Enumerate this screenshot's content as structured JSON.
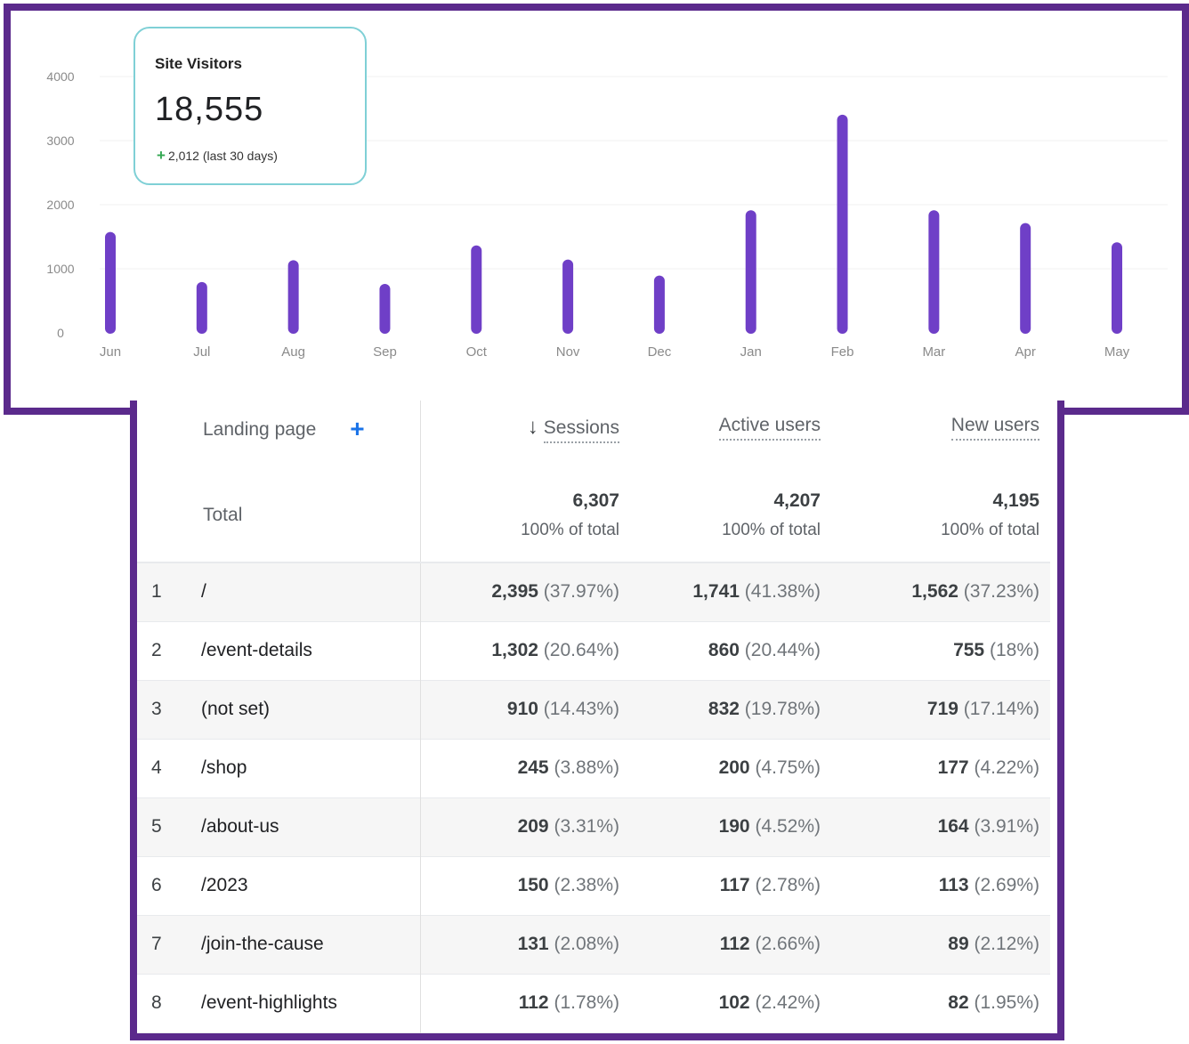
{
  "chart_data": {
    "type": "bar",
    "categories": [
      "Jun",
      "Jul",
      "Aug",
      "Sep",
      "Oct",
      "Nov",
      "Dec",
      "Jan",
      "Feb",
      "Mar",
      "Apr",
      "May"
    ],
    "values": [
      1560,
      780,
      1120,
      750,
      1350,
      1130,
      880,
      1900,
      3390,
      1900,
      1700,
      1400
    ],
    "title": "",
    "xlabel": "",
    "ylabel": "",
    "ylim": [
      0,
      4000
    ],
    "yticks": [
      0,
      1000,
      2000,
      3000,
      4000
    ],
    "grid": true,
    "bar_color": "#6f3fc7"
  },
  "kpi": {
    "title": "Site Visitors",
    "value": "18,555",
    "delta_symbol": "+",
    "delta_text": "2,012 (last 30 days)"
  },
  "table": {
    "headers": {
      "landing_page": "Landing page",
      "add_symbol": "+",
      "sort_symbol": "↓",
      "sessions": "Sessions",
      "active_users": "Active users",
      "new_users": "New users"
    },
    "total": {
      "label": "Total",
      "sessions": "6,307",
      "active_users": "4,207",
      "new_users": "4,195",
      "pct_label": "100% of total"
    },
    "rows": [
      {
        "idx": "1",
        "page": "/",
        "sessions": "2,395",
        "sessions_pct": "(37.97%)",
        "active": "1,741",
        "active_pct": "(41.38%)",
        "new": "1,562",
        "new_pct": "(37.23%)"
      },
      {
        "idx": "2",
        "page": "/event-details",
        "sessions": "1,302",
        "sessions_pct": "(20.64%)",
        "active": "860",
        "active_pct": "(20.44%)",
        "new": "755",
        "new_pct": "(18%)"
      },
      {
        "idx": "3",
        "page": "(not set)",
        "sessions": "910",
        "sessions_pct": "(14.43%)",
        "active": "832",
        "active_pct": "(19.78%)",
        "new": "719",
        "new_pct": "(17.14%)"
      },
      {
        "idx": "4",
        "page": "/shop",
        "sessions": "245",
        "sessions_pct": "(3.88%)",
        "active": "200",
        "active_pct": "(4.75%)",
        "new": "177",
        "new_pct": "(4.22%)"
      },
      {
        "idx": "5",
        "page": "/about-us",
        "sessions": "209",
        "sessions_pct": "(3.31%)",
        "active": "190",
        "active_pct": "(4.52%)",
        "new": "164",
        "new_pct": "(3.91%)"
      },
      {
        "idx": "6",
        "page": "/2023",
        "sessions": "150",
        "sessions_pct": "(2.38%)",
        "active": "117",
        "active_pct": "(2.78%)",
        "new": "113",
        "new_pct": "(2.69%)"
      },
      {
        "idx": "7",
        "page": "/join-the-cause",
        "sessions": "131",
        "sessions_pct": "(2.08%)",
        "active": "112",
        "active_pct": "(2.66%)",
        "new": "89",
        "new_pct": "(2.12%)"
      },
      {
        "idx": "8",
        "page": "/event-highlights",
        "sessions": "112",
        "sessions_pct": "(1.78%)",
        "active": "102",
        "active_pct": "(2.42%)",
        "new": "82",
        "new_pct": "(1.95%)"
      }
    ]
  }
}
